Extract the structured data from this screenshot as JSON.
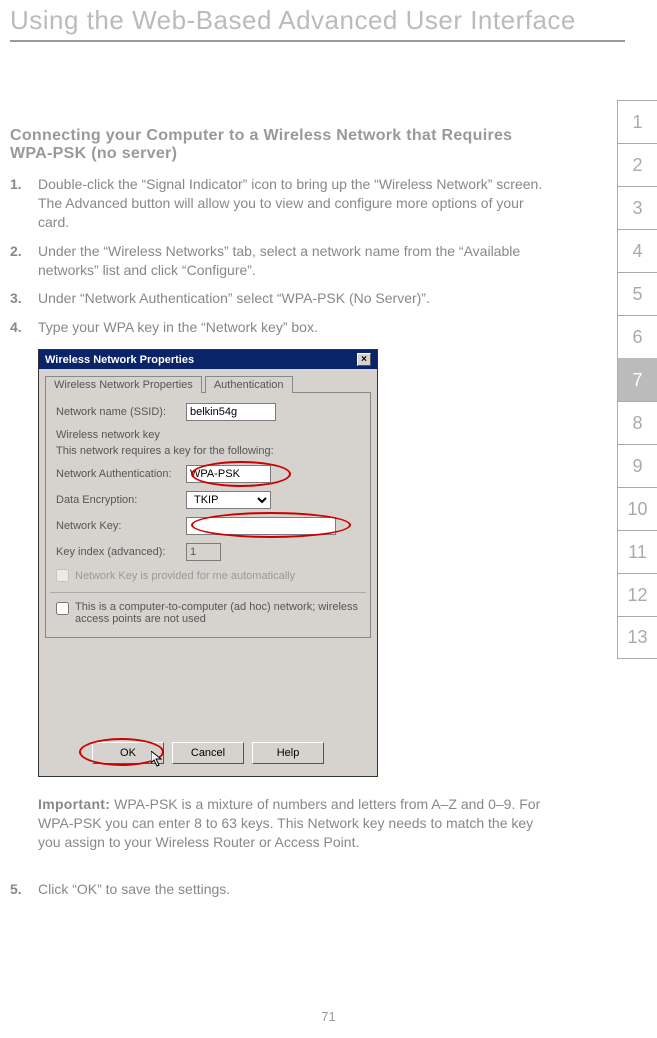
{
  "header": {
    "title": "Using the Web-Based Advanced User Interface"
  },
  "section": {
    "heading": "Connecting your Computer to a Wireless Network that Requires WPA-PSK (no server)"
  },
  "steps": {
    "s1": {
      "num": "1.",
      "text": "Double-click the “Signal Indicator” icon to bring up the “Wireless Network” screen. The Advanced button will allow you to view and configure more options of your card."
    },
    "s2": {
      "num": "2.",
      "text": "Under the “Wireless Networks” tab, select a network name from the “Available networks” list and click “Configure”."
    },
    "s3": {
      "num": "3.",
      "text": "Under “Network Authentication” select “WPA-PSK (No Server)”."
    },
    "s4": {
      "num": "4.",
      "text": "Type your WPA key in the “Network key” box."
    },
    "s5": {
      "num": "5.",
      "text": "Click “OK” to save the settings."
    }
  },
  "important": {
    "label": "Important:",
    "text": " WPA-PSK is a mixture of numbers and letters from A–Z and 0–9. For WPA-PSK you can enter 8 to 63 keys. This Network key needs to match the key you assign to your Wireless Router or Access Point."
  },
  "dialog": {
    "title": "Wireless Network Properties",
    "close": "×",
    "tab1": "Wireless Network Properties",
    "tab2": "Authentication",
    "ssid_label": "Network name (SSID):",
    "ssid_value": "belkin54g",
    "wnk_header": "Wireless network key",
    "requires_text": "This network requires a key for the following:",
    "auth_label": "Network Authentication:",
    "auth_value": "WPA-PSK",
    "enc_label": "Data Encryption:",
    "enc_value": "TKIP",
    "key_label": "Network Key:",
    "idx_label": "Key index (advanced):",
    "idx_value": "1",
    "auto_text": "Network Key is provided for me automatically",
    "adhoc_text": "This is a computer-to-computer (ad hoc) network; wireless access points are not used",
    "btn_ok": "OK",
    "btn_cancel": "Cancel",
    "btn_help": "Help"
  },
  "nav": {
    "items": [
      "1",
      "2",
      "3",
      "4",
      "5",
      "6",
      "7",
      "8",
      "9",
      "10",
      "11",
      "12",
      "13"
    ],
    "active_index": 6
  },
  "page_number": "71"
}
